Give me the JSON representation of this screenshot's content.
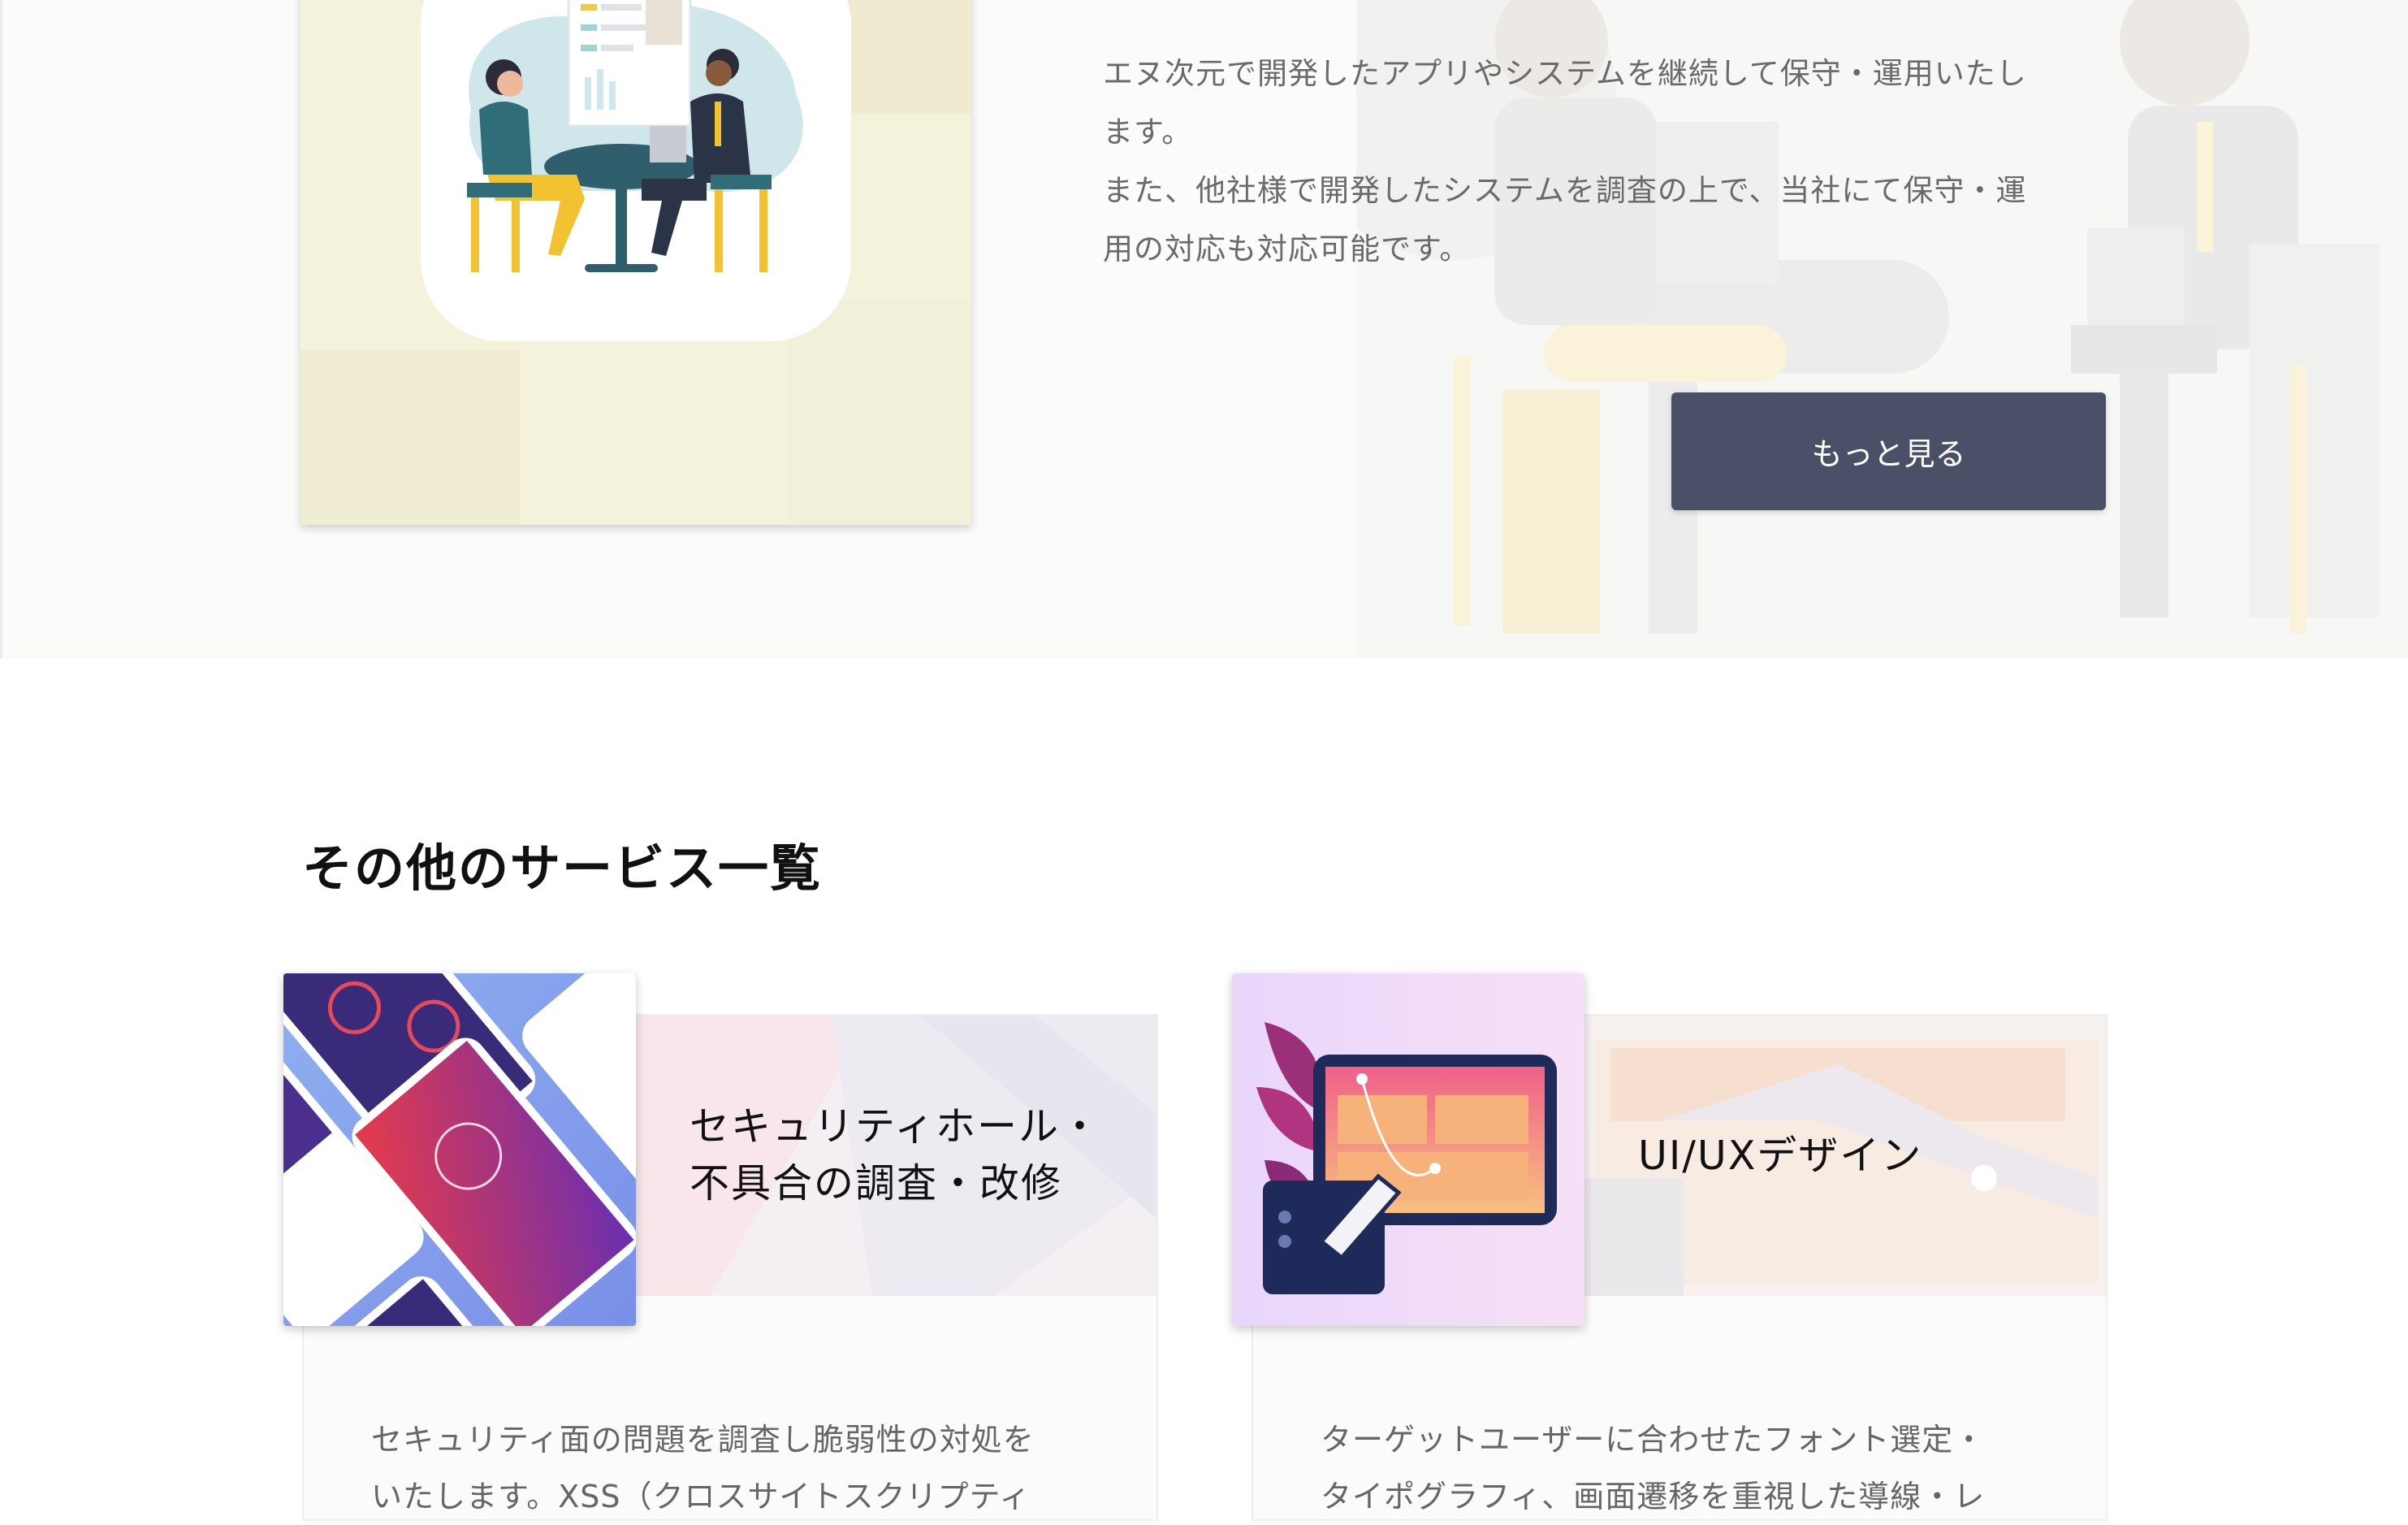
{
  "maintenance": {
    "description": [
      "エヌ次元で開発したアプリやシステムを継続して保守・運用いたし",
      "ます。",
      "また、他社様で開発したシステムを調査の上で、当社にて保守・運",
      "用の対応も対応可能です。"
    ],
    "more_button_label": "もっと見る",
    "image_icon": "meeting-illustration-icon"
  },
  "other_services": {
    "heading": "その他のサービス一覧",
    "cards": [
      {
        "title_lines": [
          "セキュリティホール・",
          "不具合の調査・改修"
        ],
        "description_lines": [
          "セキュリティ面の問題を調査し脆弱性の対処を",
          "いたします。XSS（クロスサイトスクリプティ"
        ],
        "thumbnail_icon": "mobile-app-screens-icon"
      },
      {
        "title_lines": [
          "UI/UXデザイン"
        ],
        "description_lines": [
          "ターゲットユーザーに合わせたフォント選定・",
          "タイポグラフィ、画面遷移を重視した導線・レ"
        ],
        "thumbnail_icon": "design-tablet-pen-icon"
      }
    ]
  },
  "colors": {
    "button_bg": "#4a5068",
    "card_bg": "#f5f2dc",
    "text_muted": "#6a6a6a"
  }
}
